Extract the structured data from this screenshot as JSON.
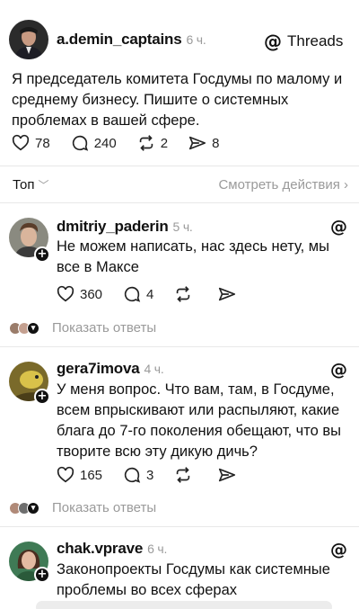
{
  "main_post": {
    "username": "a.demin_captains",
    "time": "6 ч.",
    "brand": "Threads",
    "text": "Я председатель комитета Госдумы по малому и среднему бизнесу. Пишите о системных проблемах в вашей сфере.",
    "likes": "78",
    "comments": "240",
    "reposts": "2",
    "shares": "8"
  },
  "sort": {
    "label": "Топ",
    "see_actions": "Смотреть действия ›"
  },
  "replies": [
    {
      "username": "dmitriy_paderin",
      "time": "5 ч.",
      "text": "Не можем написать, нас здесь нету, мы все в Максе",
      "likes": "360",
      "comments": "4",
      "show_replies": "Показать ответы"
    },
    {
      "username": "gera7imova",
      "time": "4 ч.",
      "text": "У меня вопрос. Что вам, там, в Госдуме, всем впрыскивают или распыляют, какие блага до 7-го поколения обещают, что вы творите всю эту дикую дичь?",
      "likes": "165",
      "comments": "3",
      "show_replies": "Показать ответы"
    },
    {
      "username": "chak.vprave",
      "time": "6 ч.",
      "text": "Законопроекты Госдумы как системные проблемы во всех сферах"
    }
  ],
  "icons": {
    "like": "heart-icon",
    "comment": "comment-icon",
    "repost": "repost-icon",
    "share": "share-icon",
    "threads": "threads-logo-icon"
  }
}
